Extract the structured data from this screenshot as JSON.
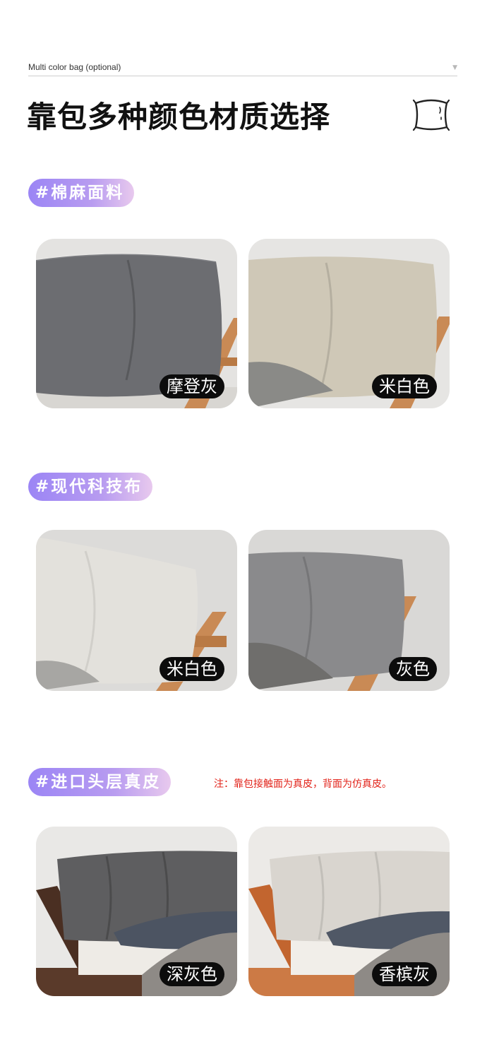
{
  "header": {
    "option_label": "Multi color bag (optional)",
    "title": "靠包多种颜色材质选择",
    "icon": "pillow-icon"
  },
  "sections": [
    {
      "tag": "#棉麻面料",
      "cards": [
        {
          "label": "摩登灰",
          "cushion_color": "#6c6d71"
        },
        {
          "label": "米白色",
          "cushion_color": "#cfc8b7"
        }
      ]
    },
    {
      "tag": "#现代科技布",
      "cards": [
        {
          "label": "米白色",
          "cushion_color": "#e3e1dc"
        },
        {
          "label": "灰色",
          "cushion_color": "#8a8a8c"
        }
      ]
    },
    {
      "tag": "#进口头层真皮",
      "note": "注：靠包接触面为真皮，背面为仿真皮。",
      "cards": [
        {
          "label": "深灰色",
          "cushion_color": "#5e5e60"
        },
        {
          "label": "香槟灰",
          "cushion_color": "#d9d5cf"
        }
      ]
    }
  ],
  "colors": {
    "tag_gradient_start": "#9b85f5",
    "tag_gradient_end": "#e8c9ee",
    "note_red": "#e2231a",
    "wood": "#c98a55"
  }
}
